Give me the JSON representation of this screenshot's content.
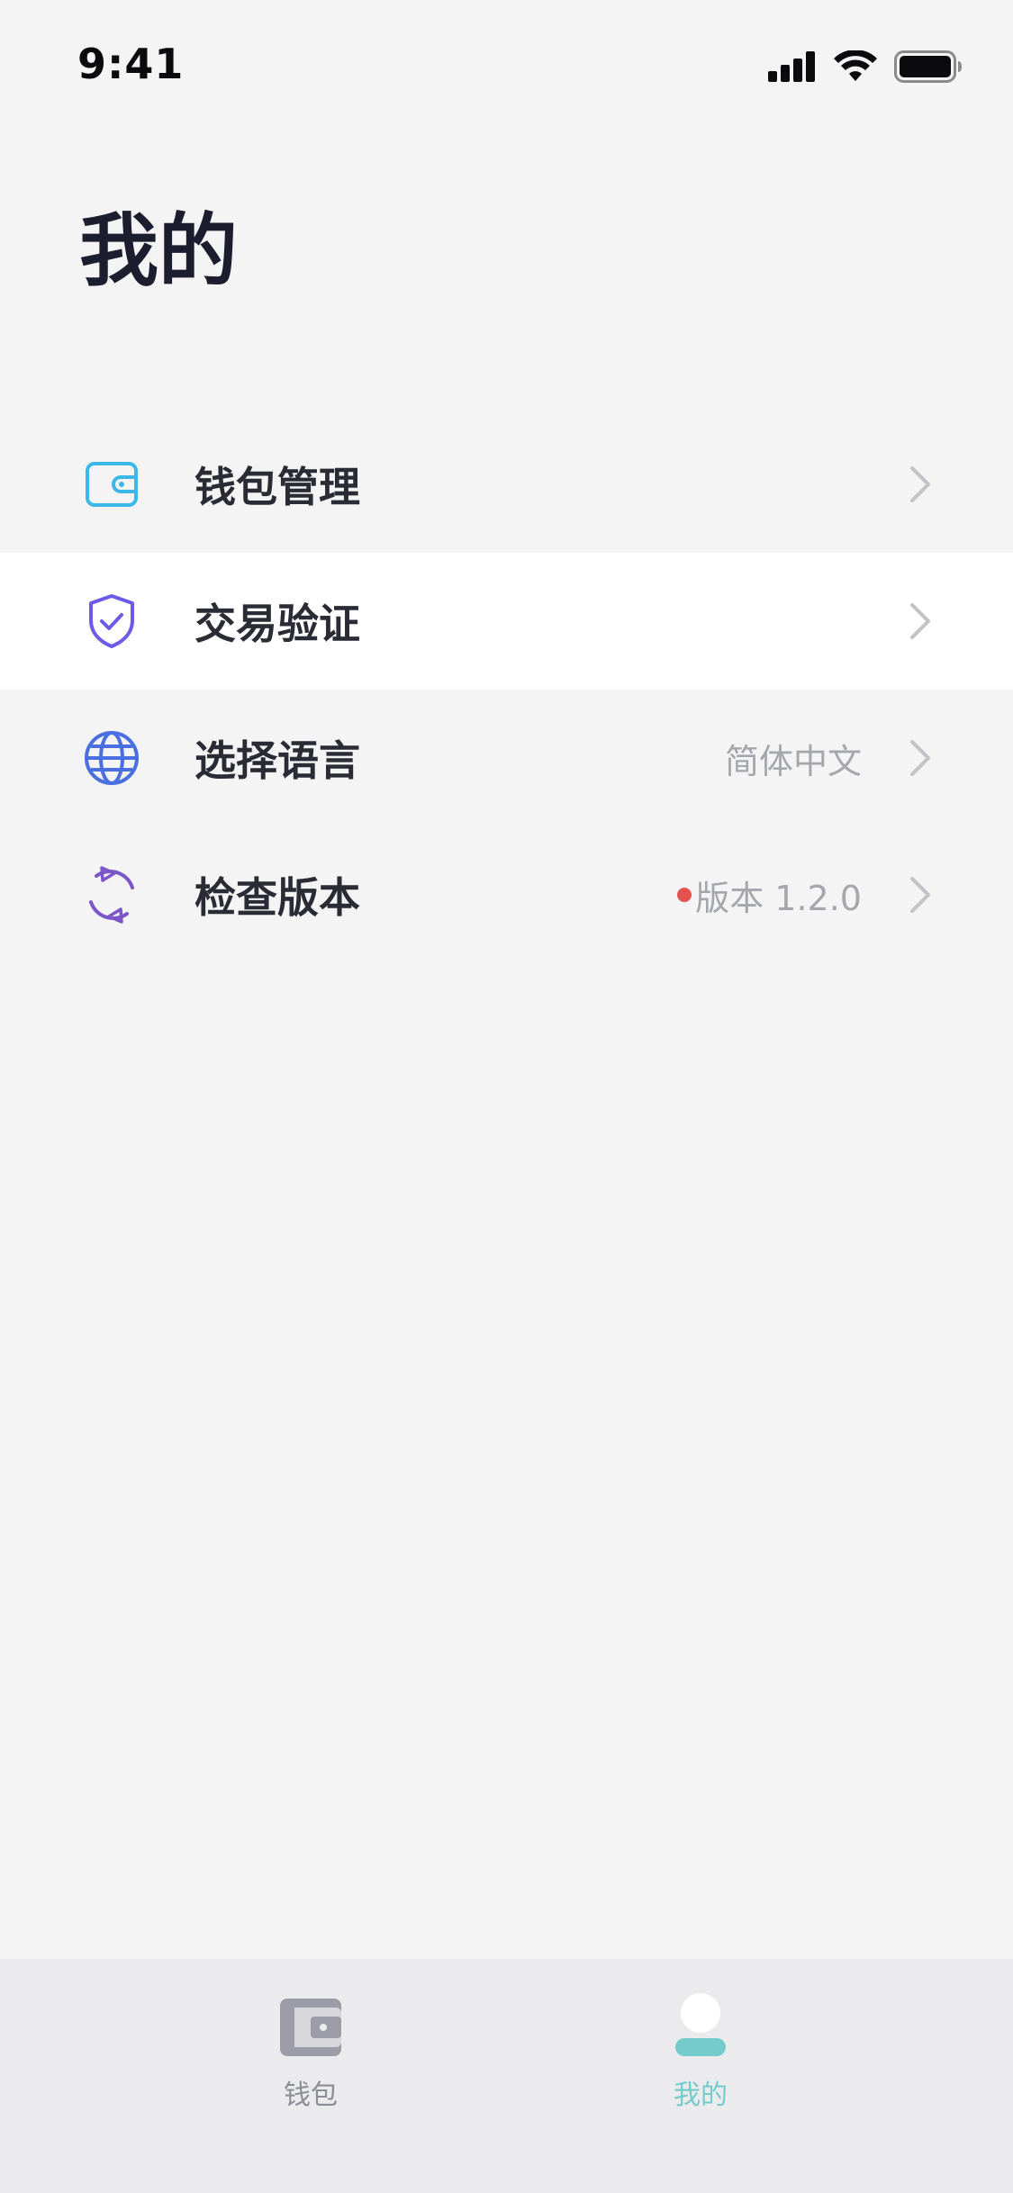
{
  "status_bar": {
    "time": "9:41"
  },
  "page": {
    "title": "我的"
  },
  "menu": {
    "items": [
      {
        "label": "钱包管理",
        "value": "",
        "icon": "wallet-icon",
        "icon_color": "#3cb8e8"
      },
      {
        "label": "交易验证",
        "value": "",
        "icon": "shield-check-icon",
        "icon_color": "#6b5be6"
      },
      {
        "label": "选择语言",
        "value": "简体中文",
        "icon": "globe-icon",
        "icon_color": "#4a6fe0"
      },
      {
        "label": "检查版本",
        "value": "版本 1.2.0",
        "icon": "refresh-icon",
        "icon_color": "#7b56c8",
        "has_update_dot": true
      }
    ]
  },
  "tab_bar": {
    "tabs": [
      {
        "label": "钱包",
        "icon": "wallet-tab-icon",
        "selected": false
      },
      {
        "label": "我的",
        "icon": "profile-tab-icon",
        "selected": true
      }
    ]
  },
  "colors": {
    "background": "#f4f4f5",
    "accent": "#74cbcc",
    "update_dot": "#e5514d",
    "title": "#1c1d2e"
  }
}
